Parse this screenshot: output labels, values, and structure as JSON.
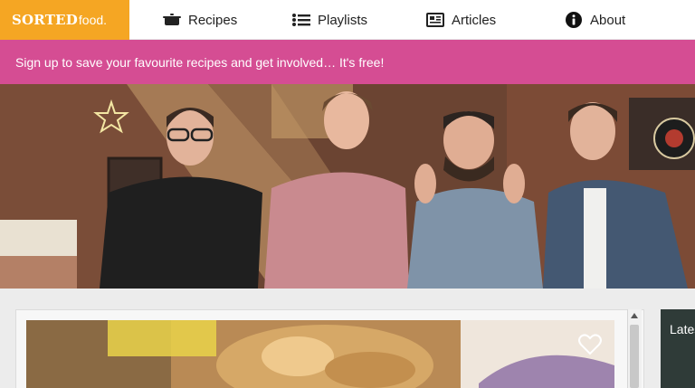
{
  "brand": {
    "name": "SORTED",
    "suffix": "food."
  },
  "nav": {
    "recipes": {
      "label": "Recipes",
      "icon": "pot-icon"
    },
    "playlists": {
      "label": "Playlists",
      "icon": "list-icon"
    },
    "articles": {
      "label": "Articles",
      "icon": "newspaper-icon"
    },
    "about": {
      "label": "About",
      "icon": "info-icon"
    }
  },
  "banner": {
    "text": "Sign up to save your favourite recipes and get involved… It's free!"
  },
  "sidebar": {
    "latest_label": "Lates"
  },
  "colors": {
    "brand_orange": "#f5a623",
    "banner_pink": "#d54d93",
    "hero_brick": "#6b4432"
  }
}
